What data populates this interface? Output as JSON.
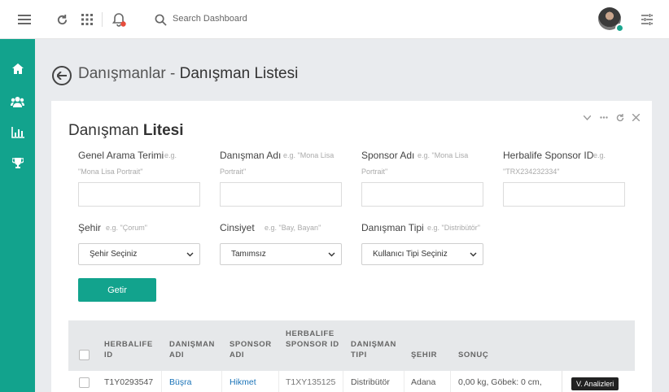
{
  "topbar": {
    "search_placeholder": "Search Dashboard"
  },
  "page": {
    "title_light": "Danışmanlar -",
    "title_bold": " Danışman Listesi"
  },
  "card": {
    "title_light": "Danışman",
    "title_bold": " Litesi"
  },
  "filters": {
    "genel": {
      "label": "Genel Arama Terimi",
      "hint": "e.g. \"Mona Lisa Portrait\""
    },
    "danisman_adi": {
      "label": "Danışman Adı",
      "hint": "e.g. \"Mona Lisa Portrait\""
    },
    "sponsor_adi": {
      "label": "Sponsor Adı",
      "hint": "e.g. \"Mona Lisa Portrait\""
    },
    "herbalife_sponsor_id": {
      "label": "Herbalife Sponsor ID",
      "hint": "e.g. \"TRX234232334\""
    },
    "sehir": {
      "label": "Şehir",
      "hint": "e.g. \"Çorum\"",
      "selected": "Şehir Seçiniz"
    },
    "cinsiyet": {
      "label": "Cinsiyet",
      "hint": "e.g. \"Bay, Bayan\"",
      "selected": "Tamımsız"
    },
    "danisman_tipi": {
      "label": "Danışman Tipi",
      "hint": "e.g. \"Distribütör\"",
      "selected": "Kullanıcı Tipi Seçiniz"
    }
  },
  "getir_label": "Getir",
  "table": {
    "headers": [
      "HERBALIFE ID",
      "DANIŞMAN ADI",
      "SPONSOR ADI",
      "HERBALIFE SPONSOR ID",
      "DANIŞMAN TIPI",
      "ŞEHIR",
      "SONUÇ"
    ],
    "rows": [
      {
        "herbalife_id": "T1Y0293547",
        "danisman_adi": "Büşra",
        "sponsor_adi": "Hikmet",
        "sponsor_id": "T1XY135125",
        "tipi": "Distribütör",
        "sehir": "Adana",
        "sonuc": "0,00 kg, Göbek: 0 cm,"
      }
    ]
  },
  "tooltip": "V. Analizleri",
  "colors": {
    "accent": "#12a38d",
    "notification": "#e74c3c",
    "link": "#1a73b8"
  }
}
